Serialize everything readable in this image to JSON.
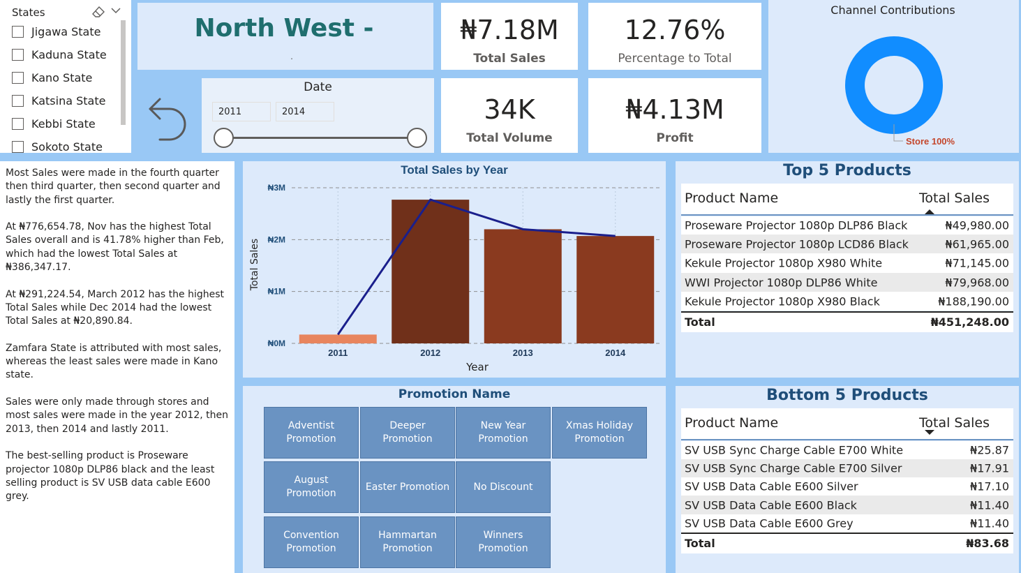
{
  "states_slicer": {
    "title": "States",
    "items": [
      "Jigawa State",
      "Kaduna State",
      "Kano State",
      "Katsina State",
      "Kebbi State",
      "Sokoto State"
    ]
  },
  "region": {
    "name": "North West -",
    "subtitle": "."
  },
  "date_slicer": {
    "title": "Date",
    "start": "2011",
    "end": "2014"
  },
  "kpis": {
    "total_sales": {
      "value": "₦7.18M",
      "label": "Total Sales"
    },
    "percentage": {
      "value": "12.76%",
      "label": "Percentage to Total"
    },
    "total_volume": {
      "value": "34K",
      "label": "Total Volume"
    },
    "profit": {
      "value": "₦4.13M",
      "label": "Profit"
    }
  },
  "channel": {
    "title": "Channel Contributions",
    "label": "Store 100%",
    "color": "#118dff",
    "label_color": "#c4462b"
  },
  "narrative": [
    "Most Sales were made in the fourth quarter then third quarter, then second quarter and lastly the first quarter.",
    "At ₦776,654.78, Nov has the highest Total Sales overall and is 41.78% higher than Feb, which had the lowest Total Sales at ₦386,347.17.",
    "At ₦291,224.54, March 2012 has the highest Total Sales while Dec 2014 had the lowest Total Sales at ₦20,890.84.",
    "Zamfara State is attributed with most sales, whereas the least sales were made in Kano state.",
    "Sales were only made through stores and most sales were made in the year 2012, then 2013, then 2014 and lastly 2011.",
    "The best-selling product is Proseware projector 1080p DLP86 black and the least selling product is SV USB data cable E600 grey."
  ],
  "chart_data": {
    "type": "bar",
    "title": "Total Sales by Year",
    "xlabel": "Year",
    "ylabel": "Total Sales",
    "categories": [
      "2011",
      "2012",
      "2013",
      "2014"
    ],
    "values": [
      0.17,
      2.77,
      2.2,
      2.07
    ],
    "line_values": [
      0.17,
      2.77,
      2.2,
      2.07
    ],
    "ylim": [
      0,
      3
    ],
    "yticks": [
      0,
      1,
      2,
      3
    ],
    "ytick_labels": [
      "₦0M",
      "₦1M",
      "₦2M",
      "₦3M"
    ],
    "bar_colors": [
      "#e8855e",
      "#70301a",
      "#8a3a1f",
      "#8a3a1f"
    ],
    "line_color": "#1a1f8c",
    "grid": true
  },
  "promotion": {
    "title": "Promotion Name",
    "buttons": [
      "Adventist Promotion",
      "Deeper Promotion",
      "New Year Promotion",
      "Xmas Holiday Promotion",
      "August Promotion",
      "Easter Promotion",
      "No Discount",
      "Convention Promotion",
      "Hammartan Promotion",
      "Winners Promotion"
    ]
  },
  "top5": {
    "title": "Top 5 Products",
    "col1": "Product Name",
    "col2": "Total Sales",
    "rows": [
      {
        "name": "Proseware Projector 1080p DLP86 Black",
        "value": "₦49,980.00"
      },
      {
        "name": "Proseware Projector 1080p LCD86 Black",
        "value": "₦61,965.00"
      },
      {
        "name": "Kekule Projector 1080p X980 White",
        "value": "₦71,145.00"
      },
      {
        "name": "WWI Projector 1080p DLP86 White",
        "value": "₦79,968.00"
      },
      {
        "name": "Kekule Projector 1080p X980 Black",
        "value": "₦188,190.00"
      }
    ],
    "total_label": "Total",
    "total_value": "₦451,248.00"
  },
  "bottom5": {
    "title": "Bottom 5 Products",
    "col1": "Product Name",
    "col2": "Total Sales",
    "rows": [
      {
        "name": "SV USB Sync Charge Cable E700 White",
        "value": "₦25.87"
      },
      {
        "name": "SV USB Sync Charge Cable E700 Silver",
        "value": "₦17.91"
      },
      {
        "name": "SV USB Data Cable E600 Silver",
        "value": "₦17.10"
      },
      {
        "name": "SV USB Data Cable E600 Black",
        "value": "₦11.40"
      },
      {
        "name": "SV USB Data Cable E600 Grey",
        "value": "₦11.40"
      }
    ],
    "total_label": "Total",
    "total_value": "₦83.68"
  }
}
